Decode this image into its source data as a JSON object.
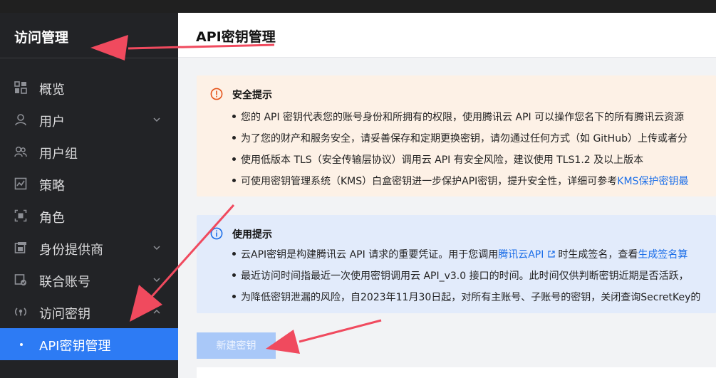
{
  "sidebar": {
    "title": "访问管理",
    "items": [
      {
        "label": "概览",
        "icon": "grid-icon"
      },
      {
        "label": "用户",
        "icon": "user-icon"
      },
      {
        "label": "用户组",
        "icon": "users-icon"
      },
      {
        "label": "策略",
        "icon": "policy-icon"
      },
      {
        "label": "角色",
        "icon": "role-icon"
      },
      {
        "label": "身份提供商",
        "icon": "idp-icon"
      },
      {
        "label": "联合账号",
        "icon": "federated-account-icon"
      },
      {
        "label": "访问密钥",
        "icon": "key-icon"
      },
      {
        "label": "API密钥管理"
      }
    ]
  },
  "header": {
    "title": "API密钥管理"
  },
  "security_notice": {
    "title": "安全提示",
    "lines": [
      "您的 API 密钥代表您的账号身份和所拥有的权限，使用腾讯云 API 可以操作您名下的所有腾讯云资源",
      "为了您的财产和服务安全，请妥善保存和定期更换密钥，请勿通过任何方式（如 GitHub）上传或者分",
      "使用低版本 TLS（安全传输层协议）调用云 API 有安全风险，建议使用 TLS1.2 及以上版本"
    ],
    "line4_prefix": "可使用密钥管理系统（KMS）白盒密钥进一步保护API密钥，提升安全性，详细可参考",
    "line4_link": "KMS保护密钥最"
  },
  "usage_notice": {
    "title": "使用提示",
    "line1_prefix": "云API密钥是构建腾讯云 API 请求的重要凭证。用于您调用",
    "line1_link": "腾讯云API",
    "line1_middle": "时生成签名，查看",
    "line1_link2": "生成签名算",
    "line2": "最近访问时间指最近一次使用密钥调用云 API_v3.0 接口的时间。此时间仅供判断密钥近期是否活跃，",
    "line3": "为降低密钥泄漏的风险，自2023年11月30日起，对所有主账号、子账号的密钥，关闭查询SecretKey的"
  },
  "actions": {
    "new_key": "新建密钥"
  },
  "colors": {
    "sidebar_bg": "#222326",
    "active": "#2d7bf4",
    "warn_bg": "#fdf1e6",
    "info_bg": "#e2ebfb",
    "link": "#1b6ee8",
    "annotation_arrow": "#f04a5e"
  }
}
